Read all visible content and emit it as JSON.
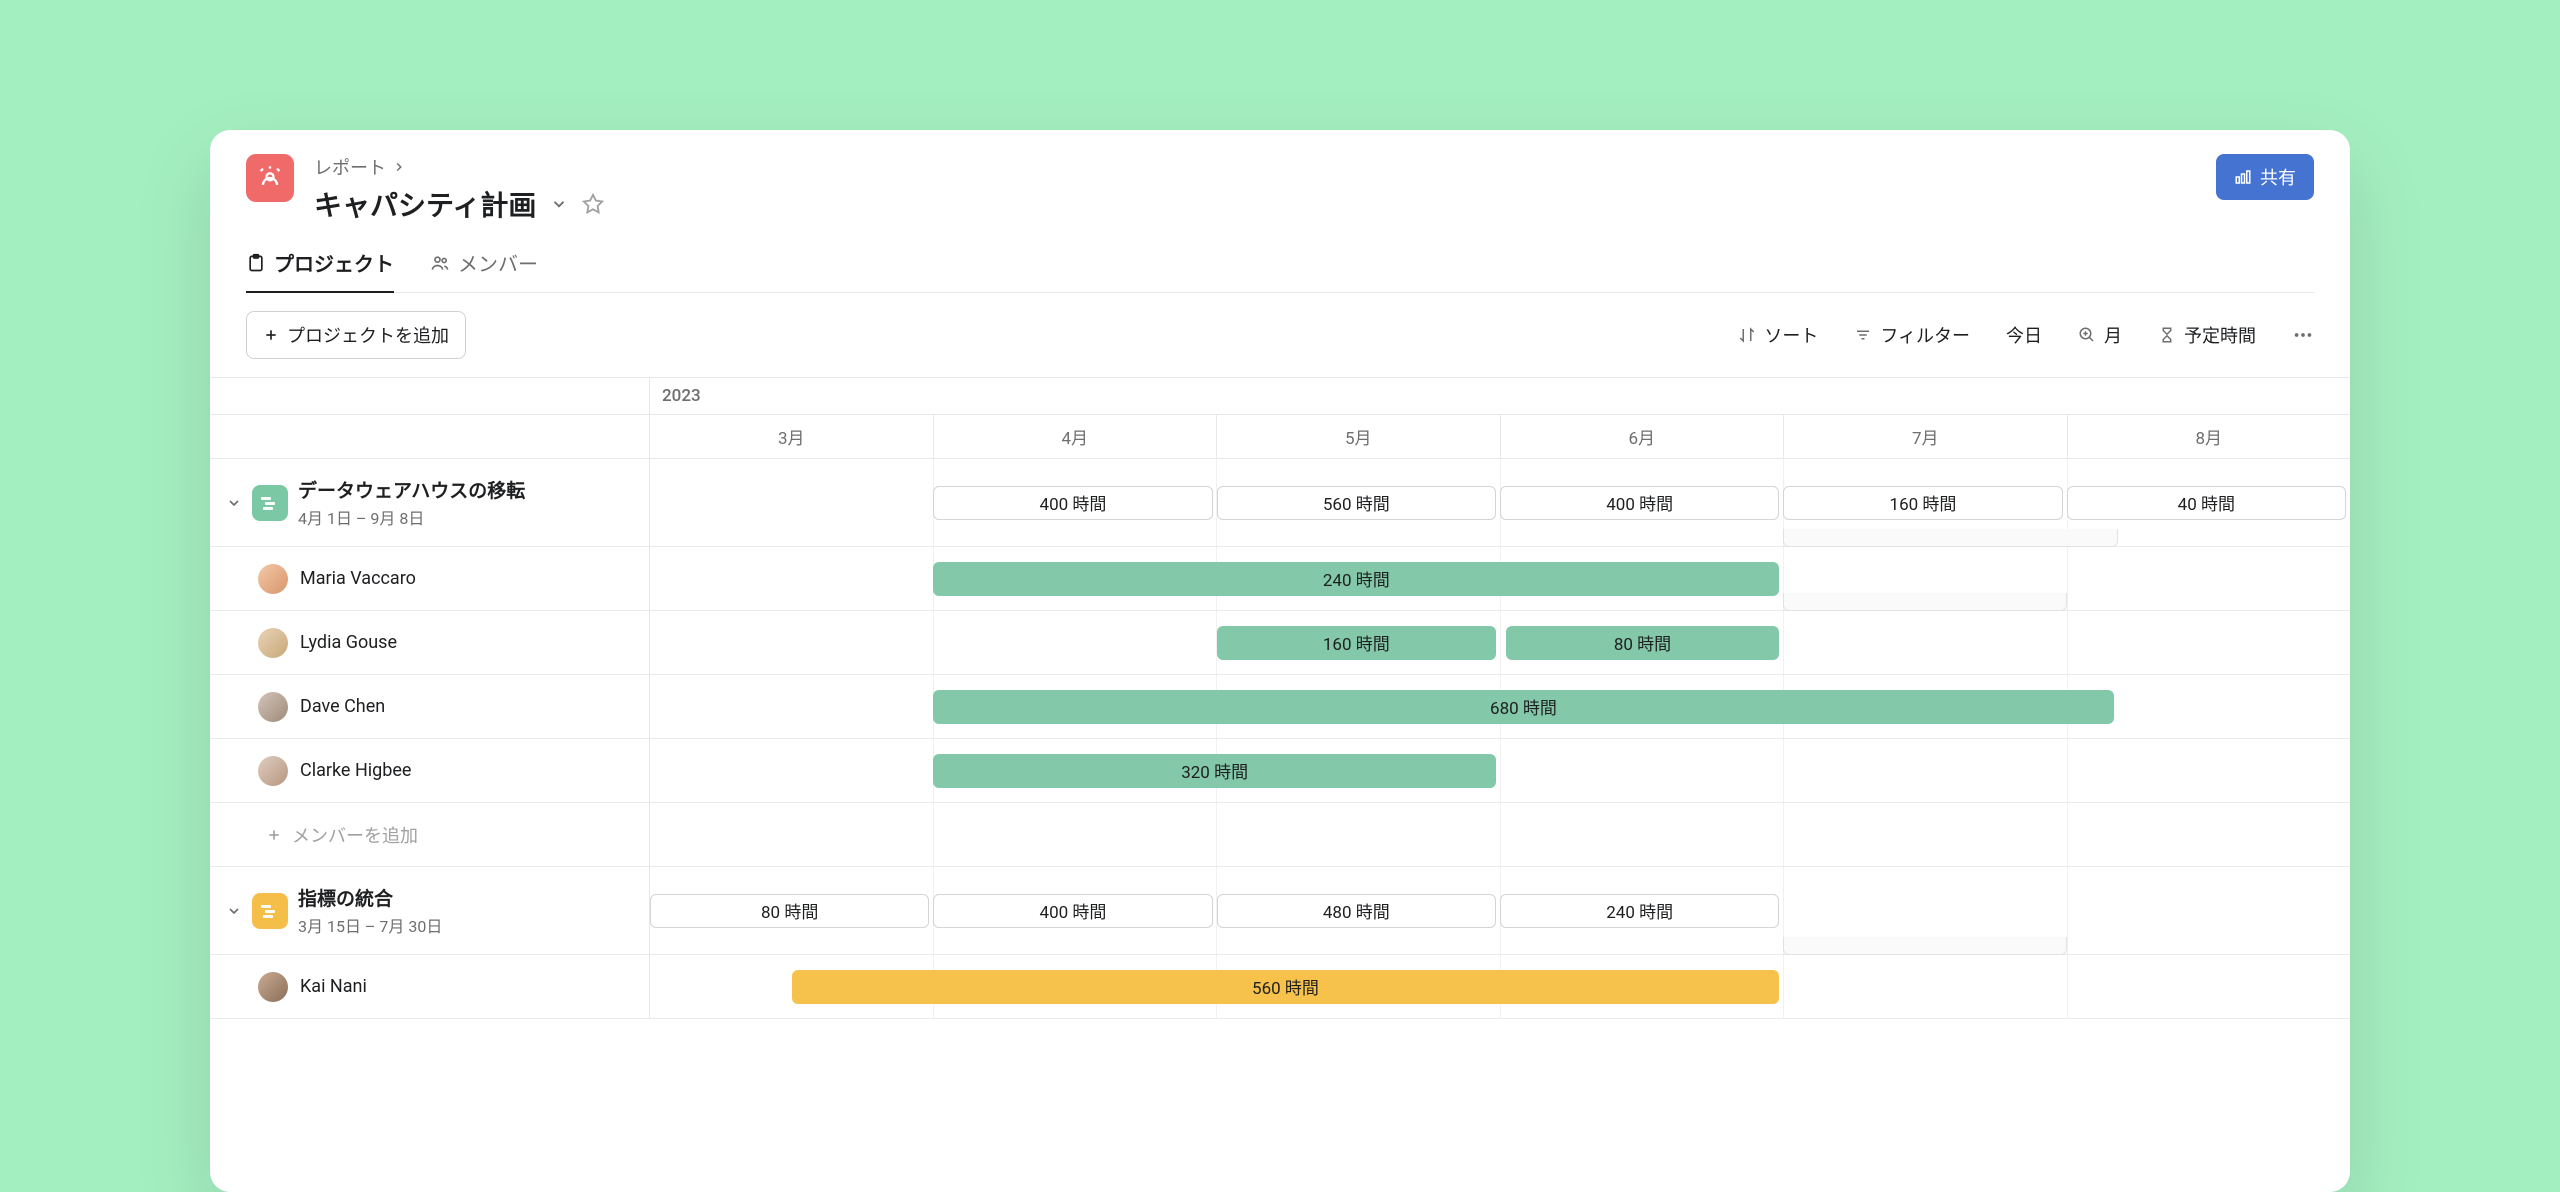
{
  "breadcrumb": {
    "parent": "レポート"
  },
  "title": "キャパシティ計画",
  "share_label": "共有",
  "tabs": {
    "projects": "プロジェクト",
    "members": "メンバー"
  },
  "toolbar": {
    "add_project": "プロジェクトを追加",
    "sort": "ソート",
    "filter": "フィルター",
    "today": "今日",
    "zoom": "月",
    "scheduled": "予定時間"
  },
  "timeline": {
    "year": "2023",
    "months": [
      "3月",
      "4月",
      "5月",
      "6月",
      "7月",
      "8月"
    ]
  },
  "projects": [
    {
      "name": "データウェアハウスの移転",
      "range": "4月 1日 – 9月 8日",
      "color": "green",
      "bars": [
        {
          "label": "400 時間",
          "start": 1.0,
          "span": 1.0
        },
        {
          "label": "560 時間",
          "start": 2.0,
          "span": 1.0
        },
        {
          "label": "400 時間",
          "start": 3.0,
          "span": 1.0
        },
        {
          "label": "160 時間",
          "start": 4.0,
          "span": 1.0
        },
        {
          "label": "40 時間",
          "start": 5.0,
          "span": 1.0
        }
      ],
      "extender": {
        "start": 4.0,
        "span": 1.18
      },
      "members": [
        {
          "name": "Maria Vaccaro",
          "avatar": "a1",
          "bars": [
            {
              "label": "240 時間",
              "start": 1.0,
              "span": 3.0,
              "fill": "green"
            }
          ],
          "extender": {
            "start": 4.0,
            "span": 1.0
          }
        },
        {
          "name": "Lydia Gouse",
          "avatar": "a2",
          "bars": [
            {
              "label": "160 時間",
              "start": 2.0,
              "span": 1.0,
              "fill": "green"
            },
            {
              "label": "80 時間",
              "start": 3.02,
              "span": 0.98,
              "fill": "green"
            }
          ]
        },
        {
          "name": "Dave Chen",
          "avatar": "a3",
          "bars": [
            {
              "label": "680 時間",
              "start": 1.0,
              "span": 4.18,
              "fill": "green"
            }
          ]
        },
        {
          "name": "Clarke Higbee",
          "avatar": "a4",
          "bars": [
            {
              "label": "320 時間",
              "start": 1.0,
              "span": 2.0,
              "fill": "green"
            }
          ]
        }
      ]
    },
    {
      "name": "指標の統合",
      "range": "3月 15日 – 7月 30日",
      "color": "yellow",
      "bars": [
        {
          "label": "80 時間",
          "start": 0.0,
          "span": 1.0
        },
        {
          "label": "400 時間",
          "start": 1.0,
          "span": 1.0
        },
        {
          "label": "480 時間",
          "start": 2.0,
          "span": 1.0
        },
        {
          "label": "240 時間",
          "start": 3.0,
          "span": 1.0
        }
      ],
      "extender": {
        "start": 4.0,
        "span": 1.0
      },
      "members": [
        {
          "name": "Kai Nani",
          "avatar": "a5",
          "bars": [
            {
              "label": "560 時間",
              "start": 0.5,
              "span": 3.5,
              "fill": "yellow"
            }
          ]
        }
      ]
    }
  ],
  "add_member_label": "メンバーを追加"
}
